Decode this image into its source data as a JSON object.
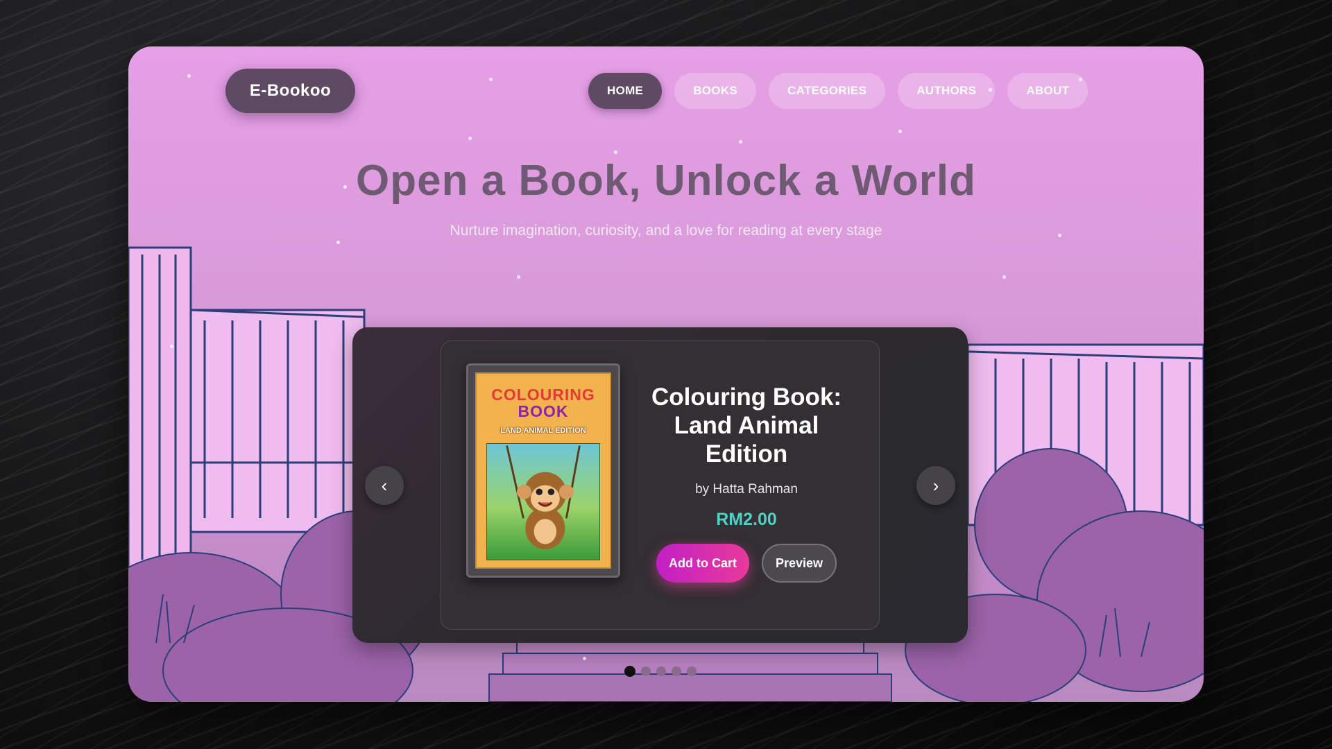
{
  "brand": {
    "logo": "E-Bookoo"
  },
  "nav": {
    "items": [
      {
        "label": "HOME",
        "active": true
      },
      {
        "label": "BOOKS",
        "active": false
      },
      {
        "label": "CATEGORIES",
        "active": false
      },
      {
        "label": "AUTHORS",
        "active": false
      },
      {
        "label": "ABOUT",
        "active": false
      }
    ]
  },
  "hero": {
    "title": "Open a Book, Unlock a World",
    "subtitle": "Nurture imagination, curiosity, and a love for reading at every stage"
  },
  "carousel": {
    "prev_icon": "‹",
    "next_icon": "›",
    "slide": {
      "cover": {
        "title_line1": "COLOURING",
        "title_line2": "BOOK",
        "subtitle": "LAND ANIMAL EDITION"
      },
      "title": "Colouring Book: Land Animal Edition",
      "author": "by Hatta Rahman",
      "price": "RM2.00",
      "add_to_cart_label": "Add to Cart",
      "preview_label": "Preview"
    },
    "dots_total": 5,
    "active_dot": 0
  },
  "colors": {
    "accent": "#c21fc6",
    "price": "#4fd1c5",
    "nav_active": "#5e4a63",
    "title": "#6e5a72"
  }
}
